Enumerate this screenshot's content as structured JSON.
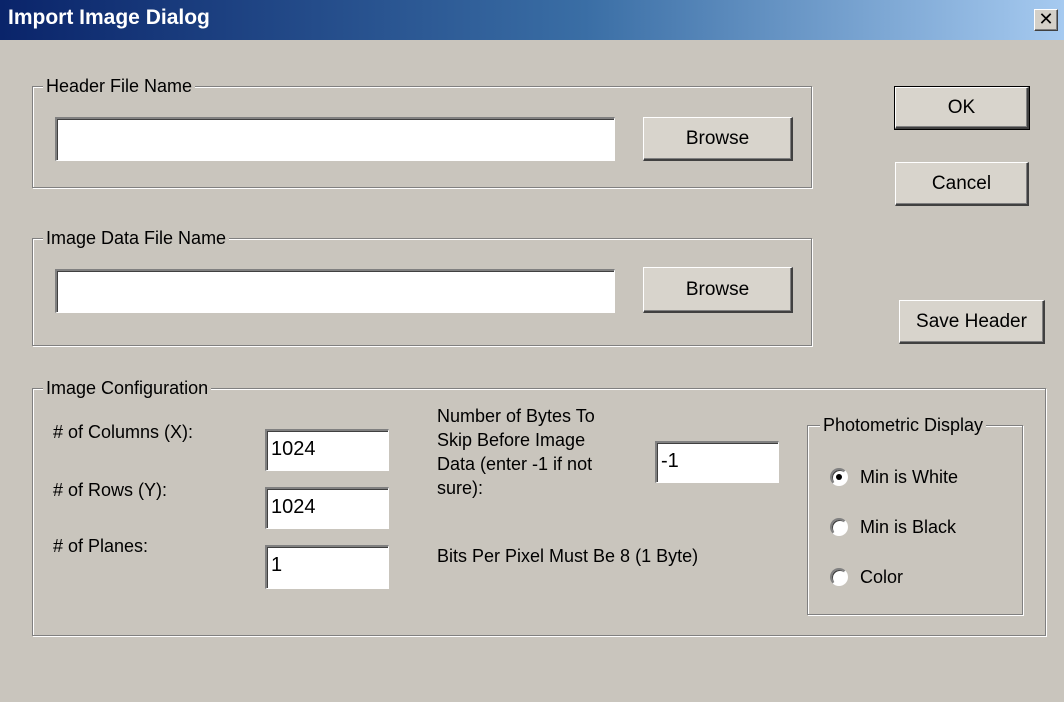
{
  "window": {
    "title": "Import Image Dialog",
    "close_glyph": "✕"
  },
  "header_file": {
    "legend": "Header File Name",
    "value": "",
    "browse_label": "Browse"
  },
  "image_data_file": {
    "legend": "Image Data File Name",
    "value": "",
    "browse_label": "Browse"
  },
  "buttons": {
    "ok_label": "OK",
    "cancel_label": "Cancel",
    "save_header_label": "Save Header"
  },
  "config": {
    "legend": "Image Configuration",
    "columns_label": "# of Columns (X):",
    "columns_value": "1024",
    "rows_label": "# of Rows (Y):",
    "rows_value": "1024",
    "planes_label": "# of Planes:",
    "planes_value": "1",
    "skip_bytes_line1": "Number of Bytes To",
    "skip_bytes_line2": "Skip Before Image",
    "skip_bytes_line3": "Data (enter -1 if not",
    "skip_bytes_line4": "sure):",
    "skip_bytes_value": "-1",
    "bits_note": "Bits Per Pixel Must Be 8 (1 Byte)"
  },
  "photometric": {
    "legend": "Photometric Display",
    "options": [
      {
        "label": "Min is White",
        "selected": true
      },
      {
        "label": "Min is Black",
        "selected": false
      },
      {
        "label": "Color",
        "selected": false
      }
    ]
  }
}
